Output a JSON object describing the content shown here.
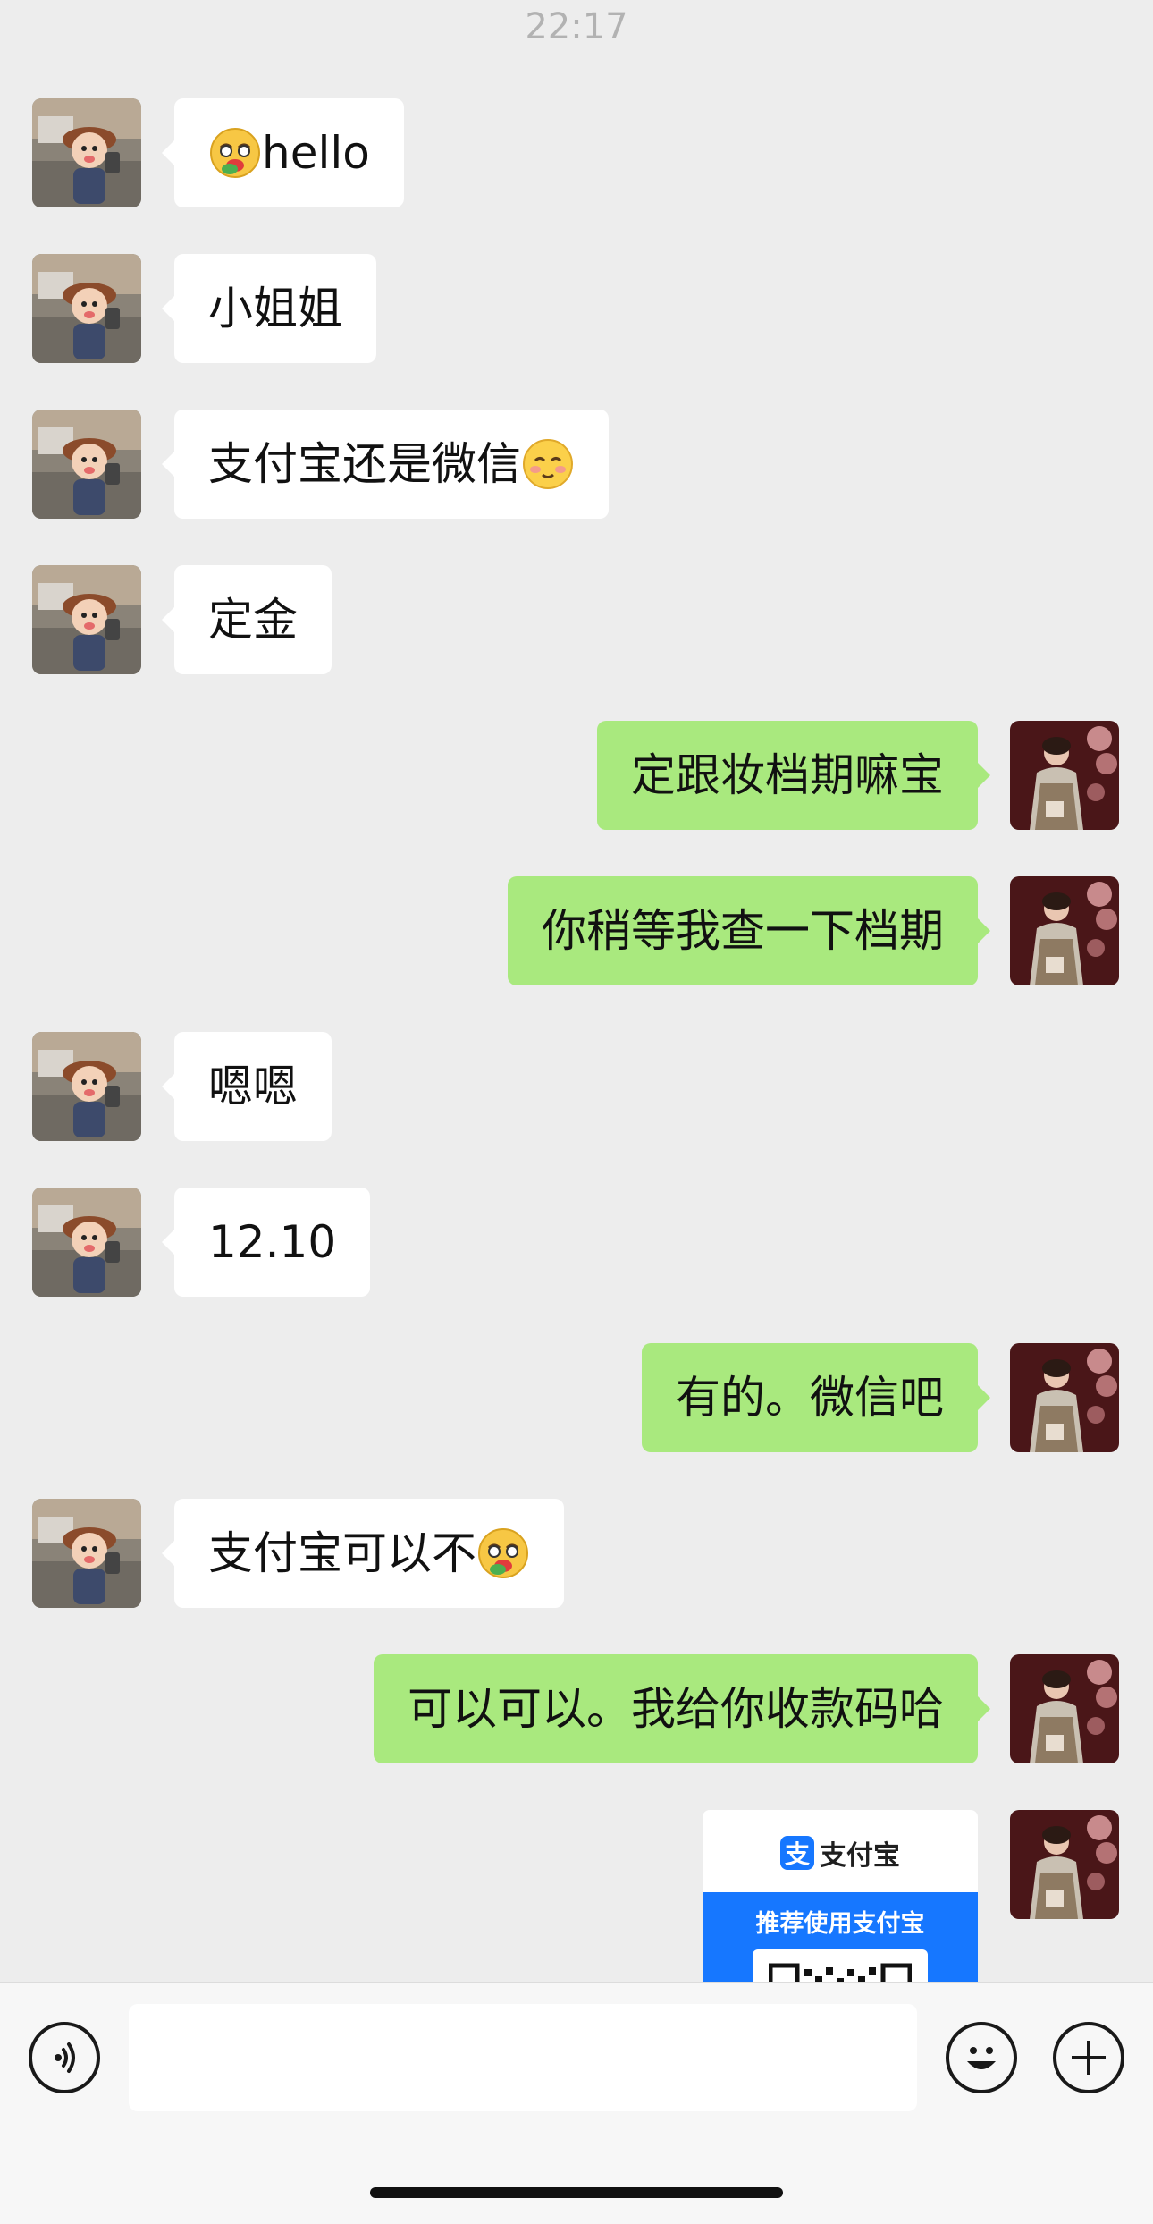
{
  "timestamp": "22:17",
  "messages": [
    {
      "side": "left",
      "text": "hello",
      "emoji_before": "hot-face-emoji"
    },
    {
      "side": "left",
      "text": "小姐姐"
    },
    {
      "side": "left",
      "text": "支付宝还是微信",
      "emoji_after": "blush-smile-emoji"
    },
    {
      "side": "left",
      "text": "定金"
    },
    {
      "side": "right",
      "text": "定跟妆档期嘛宝"
    },
    {
      "side": "right",
      "text": "你稍等我查一下档期"
    },
    {
      "side": "left",
      "text": "嗯嗯"
    },
    {
      "side": "left",
      "text": "12.10"
    },
    {
      "side": "right",
      "text": "有的。微信吧"
    },
    {
      "side": "left",
      "text": "支付宝可以不",
      "emoji_after": "hot-face-emoji"
    },
    {
      "side": "right",
      "text": "可以可以。我给你收款码哈"
    }
  ],
  "payment_card": {
    "brand_logo_char": "支",
    "brand_name": "支付宝",
    "recommend_text": "推荐使用支付宝"
  },
  "input_bar": {
    "placeholder": "",
    "voice_icon": "voice-icon",
    "emoji_icon": "emoji-icon",
    "plus_icon": "plus-icon"
  },
  "colors": {
    "background": "#ededed",
    "bubble_left": "#ffffff",
    "bubble_right": "#a9e97e",
    "alipay_blue": "#1677ff"
  }
}
